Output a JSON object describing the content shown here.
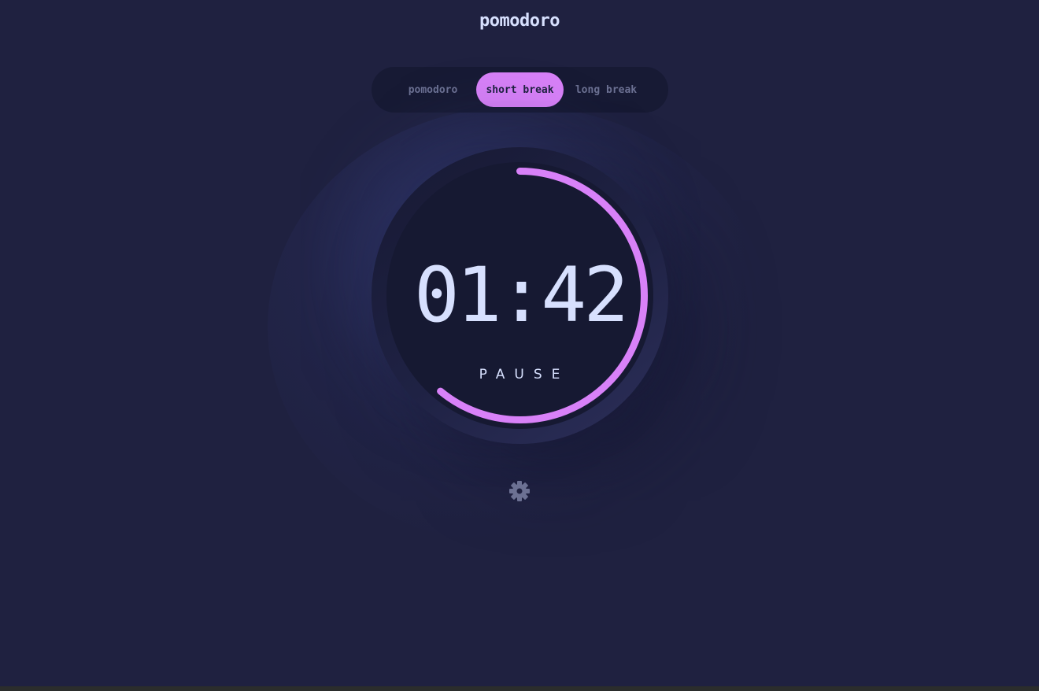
{
  "app": {
    "title": "pomodoro"
  },
  "modes": [
    {
      "label": "pomodoro",
      "active": false
    },
    {
      "label": "short break",
      "active": true
    },
    {
      "label": "long break",
      "active": false
    }
  ],
  "timer": {
    "time": "01:42",
    "action_label": "PAUSE",
    "progress_remaining": 0.61
  },
  "settings": {
    "icon": "gear-icon"
  },
  "colors": {
    "background": "#1f2140",
    "accent": "#d881f8",
    "text": "#d7e0fe",
    "muted": "#6c7193"
  }
}
